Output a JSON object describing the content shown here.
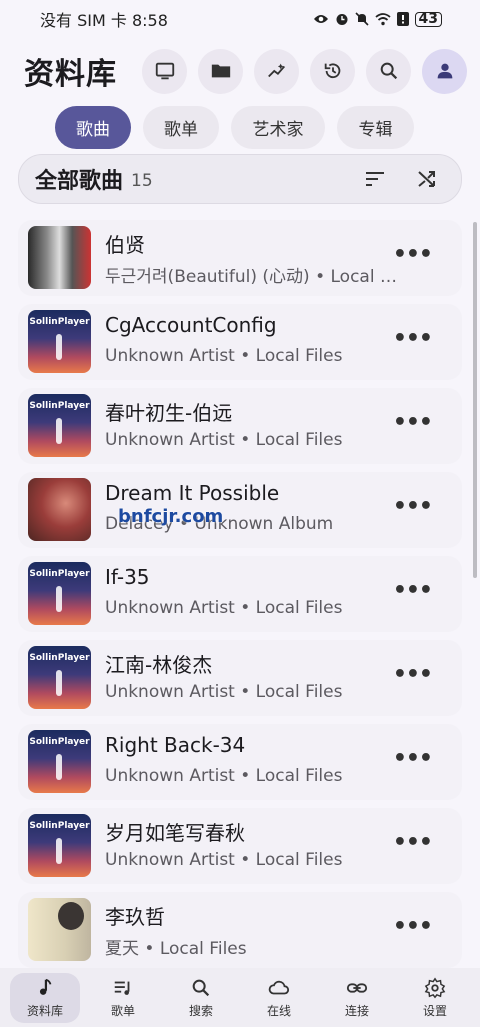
{
  "status_bar": {
    "carrier_time": "没有 SIM 卡 8:58",
    "battery": "43"
  },
  "header": {
    "title": "资料库",
    "actions": [
      "monitor-icon",
      "folder-icon",
      "trending-icon",
      "history-icon",
      "search-icon",
      "profile-icon"
    ]
  },
  "tabs": [
    {
      "label": "歌曲",
      "active": true
    },
    {
      "label": "歌单",
      "active": false
    },
    {
      "label": "艺术家",
      "active": false
    },
    {
      "label": "专辑",
      "active": false
    }
  ],
  "all_songs": {
    "title": "全部歌曲",
    "count": "15"
  },
  "songs": [
    {
      "title": "伯贤",
      "subtitle": "두근거려(Beautiful) (心动) • Local Files",
      "cover": "group"
    },
    {
      "title": "CgAccountConfig",
      "subtitle": "Unknown Artist • Local Files",
      "cover": "solin"
    },
    {
      "title": "春叶初生-伯远",
      "subtitle": "Unknown Artist • Local Files",
      "cover": "solin"
    },
    {
      "title": "Dream It Possible",
      "subtitle": "Delacey • Unknown Album",
      "cover": "dream"
    },
    {
      "title": "If-35",
      "subtitle": "Unknown Artist • Local Files",
      "cover": "solin"
    },
    {
      "title": "江南-林俊杰",
      "subtitle": "Unknown Artist • Local Files",
      "cover": "solin"
    },
    {
      "title": "Right Back-34",
      "subtitle": "Unknown Artist • Local Files",
      "cover": "solin"
    },
    {
      "title": "岁月如笔写春秋",
      "subtitle": "Unknown Artist • Local Files",
      "cover": "solin"
    },
    {
      "title": "李玖哲",
      "subtitle": "夏天 • Local Files",
      "cover": "li"
    }
  ],
  "cover_text": "SollinPlayer",
  "watermark": "bnfcjr.com",
  "more_label": "•••",
  "bottom_nav": [
    {
      "label": "资料库",
      "icon": "music-note-icon",
      "active": true
    },
    {
      "label": "歌单",
      "icon": "playlist-icon",
      "active": false
    },
    {
      "label": "搜索",
      "icon": "search-icon",
      "active": false
    },
    {
      "label": "在线",
      "icon": "cloud-icon",
      "active": false
    },
    {
      "label": "连接",
      "icon": "link-icon",
      "active": false
    },
    {
      "label": "设置",
      "icon": "settings-icon",
      "active": false
    }
  ],
  "colors": {
    "accent": "#58579a",
    "background": "#f7f5fb"
  }
}
